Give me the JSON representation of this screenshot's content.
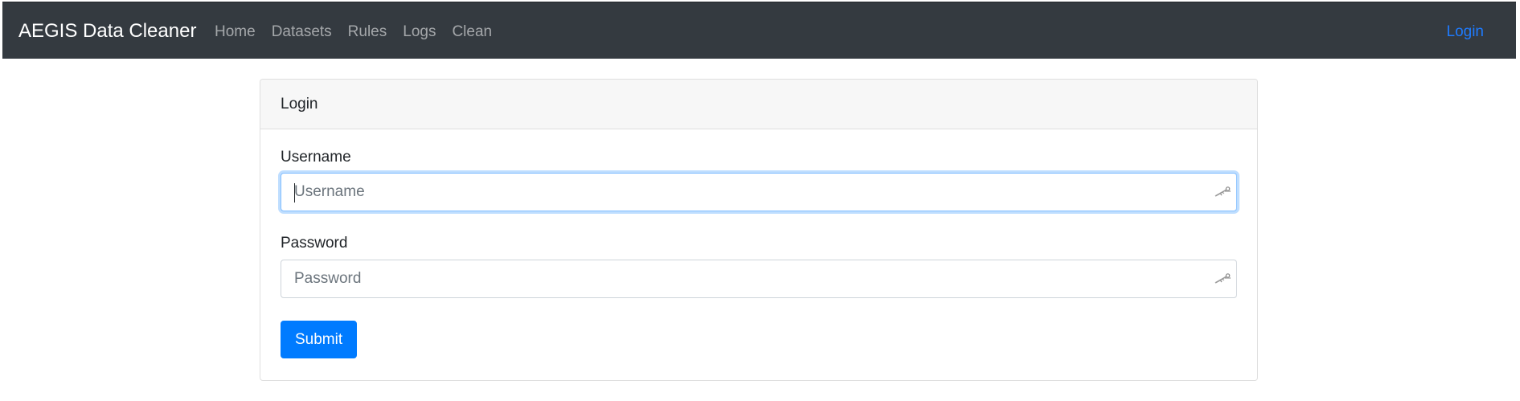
{
  "navbar": {
    "brand": "AEGIS Data Cleaner",
    "items": [
      {
        "label": "Home"
      },
      {
        "label": "Datasets"
      },
      {
        "label": "Rules"
      },
      {
        "label": "Logs"
      },
      {
        "label": "Clean"
      }
    ],
    "login": "Login"
  },
  "card": {
    "title": "Login",
    "username": {
      "label": "Username",
      "placeholder": "Username",
      "value": "",
      "focused": true,
      "icon": "key-icon"
    },
    "password": {
      "label": "Password",
      "placeholder": "Password",
      "value": "",
      "icon": "key-icon"
    },
    "submit_label": "Submit"
  },
  "colors": {
    "navbar_bg": "#343a40",
    "nav_link": "#9a9da0",
    "accent": "#007bff",
    "login_link": "#1e7bff",
    "focus_ring": "#80bdff"
  }
}
